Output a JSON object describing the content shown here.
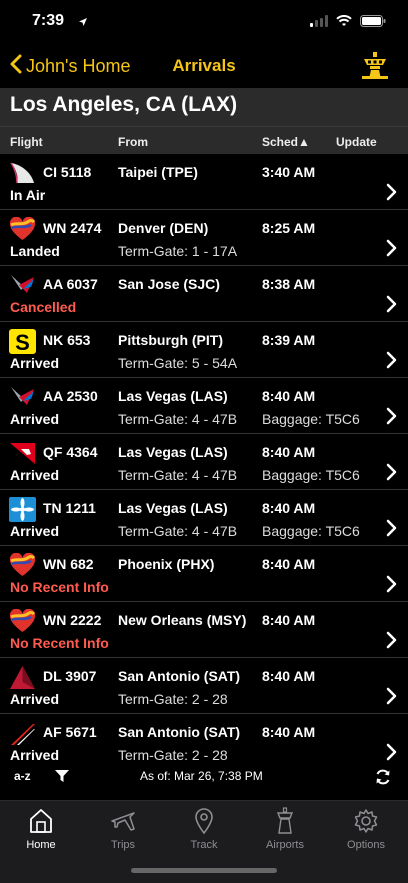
{
  "status_bar": {
    "time": "7:39"
  },
  "nav": {
    "back_label": "John's Home",
    "title": "Arrivals"
  },
  "airport": {
    "title": "Los Angeles, CA (LAX)"
  },
  "columns": {
    "flight": "Flight",
    "from": "From",
    "sched": "Sched▲",
    "update": "Update"
  },
  "flights": [
    {
      "airline": "china-airlines",
      "flight": "CI 5118",
      "status": "In Air",
      "status_color": "#ffffff",
      "from": "Taipei (TPE)",
      "gate": "",
      "sched": "3:40 AM",
      "baggage": ""
    },
    {
      "airline": "southwest",
      "flight": "WN 2474",
      "status": "Landed",
      "status_color": "#ffffff",
      "from": "Denver (DEN)",
      "gate": "Term-Gate: 1 - 17A",
      "sched": "8:25 AM",
      "baggage": ""
    },
    {
      "airline": "american",
      "flight": "AA 6037",
      "status": "Cancelled",
      "status_color": "#ff5b4f",
      "from": "San Jose (SJC)",
      "gate": "",
      "sched": "8:38 AM",
      "baggage": ""
    },
    {
      "airline": "spirit",
      "flight": "NK 653",
      "status": "Arrived",
      "status_color": "#ffffff",
      "from": "Pittsburgh (PIT)",
      "gate": "Term-Gate: 5 - 54A",
      "sched": "8:39 AM",
      "baggage": ""
    },
    {
      "airline": "american",
      "flight": "AA 2530",
      "status": "Arrived",
      "status_color": "#ffffff",
      "from": "Las Vegas (LAS)",
      "gate": "Term-Gate: 4 - 47B",
      "sched": "8:40 AM",
      "baggage": "Baggage: T5C6"
    },
    {
      "airline": "qantas",
      "flight": "QF 4364",
      "status": "Arrived",
      "status_color": "#ffffff",
      "from": "Las Vegas (LAS)",
      "gate": "Term-Gate: 4 - 47B",
      "sched": "8:40 AM",
      "baggage": "Baggage: T5C6"
    },
    {
      "airline": "air-tahiti",
      "flight": "TN 1211",
      "status": "Arrived",
      "status_color": "#ffffff",
      "from": "Las Vegas (LAS)",
      "gate": "Term-Gate: 4 - 47B",
      "sched": "8:40 AM",
      "baggage": "Baggage: T5C6"
    },
    {
      "airline": "southwest",
      "flight": "WN 682",
      "status": "No Recent Info",
      "status_color": "#ff5b4f",
      "from": "Phoenix (PHX)",
      "gate": "",
      "sched": "8:40 AM",
      "baggage": ""
    },
    {
      "airline": "southwest",
      "flight": "WN 2222",
      "status": "No Recent Info",
      "status_color": "#ff5b4f",
      "from": "New Orleans (MSY)",
      "gate": "",
      "sched": "8:40 AM",
      "baggage": ""
    },
    {
      "airline": "delta",
      "flight": "DL 3907",
      "status": "Arrived",
      "status_color": "#ffffff",
      "from": "San Antonio (SAT)",
      "gate": "Term-Gate: 2 - 28",
      "sched": "8:40 AM",
      "baggage": ""
    },
    {
      "airline": "air-france",
      "flight": "AF 5671",
      "status": "Arrived",
      "status_color": "#ffffff",
      "from": "San Antonio (SAT)",
      "gate": "Term-Gate: 2 - 28",
      "sched": "8:40 AM",
      "baggage": ""
    }
  ],
  "footer": {
    "sort_label": "a-z",
    "as_of": "As of: Mar 26, 7:38 PM"
  },
  "tabs": [
    {
      "label": "Home",
      "icon": "home-icon",
      "active": true
    },
    {
      "label": "Trips",
      "icon": "plane-icon",
      "active": false
    },
    {
      "label": "Track",
      "icon": "location-pin-icon",
      "active": false
    },
    {
      "label": "Airports",
      "icon": "control-tower-icon",
      "active": false
    },
    {
      "label": "Options",
      "icon": "gear-icon",
      "active": false
    }
  ],
  "colors": {
    "accent": "#f5c518",
    "alert": "#ff5b4f",
    "header_bg": "#2b2b2b"
  }
}
